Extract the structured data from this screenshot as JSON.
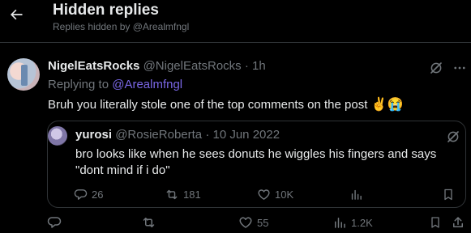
{
  "header": {
    "title": "Hidden replies",
    "subtitle": "Replies hidden by @Arealmfngl"
  },
  "tweet": {
    "display_name": "NigelEatsRocks",
    "handle": "@NigelEatsRocks",
    "separator": "·",
    "time": "1h",
    "replying_prefix": "Replying to",
    "replying_handle": "@Arealmfngl",
    "text": "Bruh you literally stole one of the top comments on the post",
    "emoji": "✌😭",
    "actions": {
      "replies": "",
      "retweets": "",
      "likes": "55",
      "views": "1.2K"
    }
  },
  "quote": {
    "display_name": "yurosi",
    "handle": "@RosieRoberta",
    "separator": "·",
    "date": "10 Jun 2022",
    "text": "bro looks like when he sees donuts he wiggles his fingers and says \"dont mind if i do\"",
    "actions": {
      "replies": "26",
      "retweets": "181",
      "likes": "10K"
    }
  },
  "colors": {
    "background": "#000000",
    "text": "#e7e9ea",
    "muted": "#71767b",
    "link": "#7a67e6",
    "border": "#2f3336"
  },
  "icons": [
    "back-arrow-icon",
    "grok-icon",
    "more-icon",
    "reply-icon",
    "retweet-icon",
    "like-icon",
    "views-icon",
    "bookmark-icon",
    "share-icon"
  ]
}
